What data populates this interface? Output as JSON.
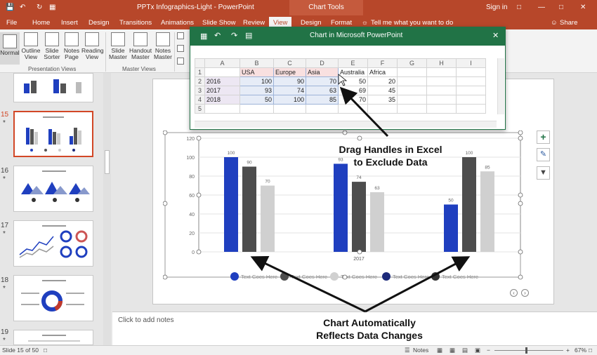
{
  "titlebar": {
    "title": "PPTx Infographics-Light  -  PowerPoint",
    "chart_tools": "Chart Tools",
    "signin": "Sign in"
  },
  "tabs": [
    "File",
    "Home",
    "Insert",
    "Design",
    "Transitions",
    "Animations",
    "Slide Show",
    "Review",
    "View",
    "Design",
    "Format"
  ],
  "tell_me": "Tell me what you want to do",
  "share": "Share",
  "ribbon": {
    "buttons": [
      {
        "label": "Normal"
      },
      {
        "label": "Outline View"
      },
      {
        "label": "Slide Sorter"
      },
      {
        "label": "Notes Page"
      },
      {
        "label": "Reading View"
      },
      {
        "label": "Slide Master"
      },
      {
        "label": "Handout Master"
      },
      {
        "label": "Notes Master"
      }
    ],
    "groups": [
      "Presentation Views",
      "Master Views"
    ]
  },
  "slides": [
    {
      "num": "15",
      "selected": true
    },
    {
      "num": "16"
    },
    {
      "num": "17"
    },
    {
      "num": "18"
    },
    {
      "num": "19"
    }
  ],
  "excel": {
    "title": "Chart in Microsoft PowerPoint",
    "col_headers": [
      "A",
      "B",
      "C",
      "D",
      "E",
      "F",
      "G",
      "H",
      "I"
    ],
    "rows": [
      {
        "n": "1",
        "cells": [
          "",
          "USA",
          "Europe",
          "Asia",
          "Australia",
          "Africa",
          "",
          "",
          ""
        ]
      },
      {
        "n": "2",
        "cells": [
          "2016",
          "100",
          "90",
          "70",
          "50",
          "20",
          "",
          "",
          ""
        ]
      },
      {
        "n": "3",
        "cells": [
          "2017",
          "93",
          "74",
          "63",
          "69",
          "45",
          "",
          "",
          ""
        ]
      },
      {
        "n": "4",
        "cells": [
          "2018",
          "50",
          "100",
          "85",
          "70",
          "35",
          "",
          "",
          ""
        ]
      },
      {
        "n": "5",
        "cells": [
          "",
          "",
          "",
          "",
          "",
          "",
          "",
          "",
          ""
        ]
      }
    ]
  },
  "chart_data": {
    "type": "bar",
    "categories": [
      "2016",
      "2017",
      "2018"
    ],
    "series": [
      {
        "values": [
          100,
          93,
          50
        ],
        "color": "#1f3fbf"
      },
      {
        "values": [
          90,
          74,
          100
        ],
        "color": "#4d4d4d"
      },
      {
        "values": [
          70,
          63,
          85
        ],
        "color": "#d0d0d0"
      }
    ],
    "ylim": [
      0,
      120
    ],
    "yticks": [
      "0",
      "20",
      "40",
      "60",
      "80",
      "100",
      "120"
    ],
    "visible_category_labels": [
      "",
      "2017",
      ""
    ],
    "legend": [
      {
        "label": "Text Goes Here",
        "color": "#1f3fbf"
      },
      {
        "label": "Text Goes Here",
        "color": "#4d4d4d"
      },
      {
        "label": "Text Goes Here",
        "color": "#d0d0d0"
      },
      {
        "label": "Text Goes Here",
        "color": "#1c2a7a"
      },
      {
        "label": "Text Goes Here",
        "color": "#333333"
      }
    ]
  },
  "annotations": {
    "top_line1": "Drag Handles in Excel",
    "top_line2": "to Exclude Data",
    "bottom_line1": "Chart Automatically",
    "bottom_line2": "Reflects Data Changes"
  },
  "notes_placeholder": "Click to add notes",
  "status": {
    "slide_info": "Slide 15 of 50",
    "notes": "Notes",
    "zoom": "67%"
  }
}
